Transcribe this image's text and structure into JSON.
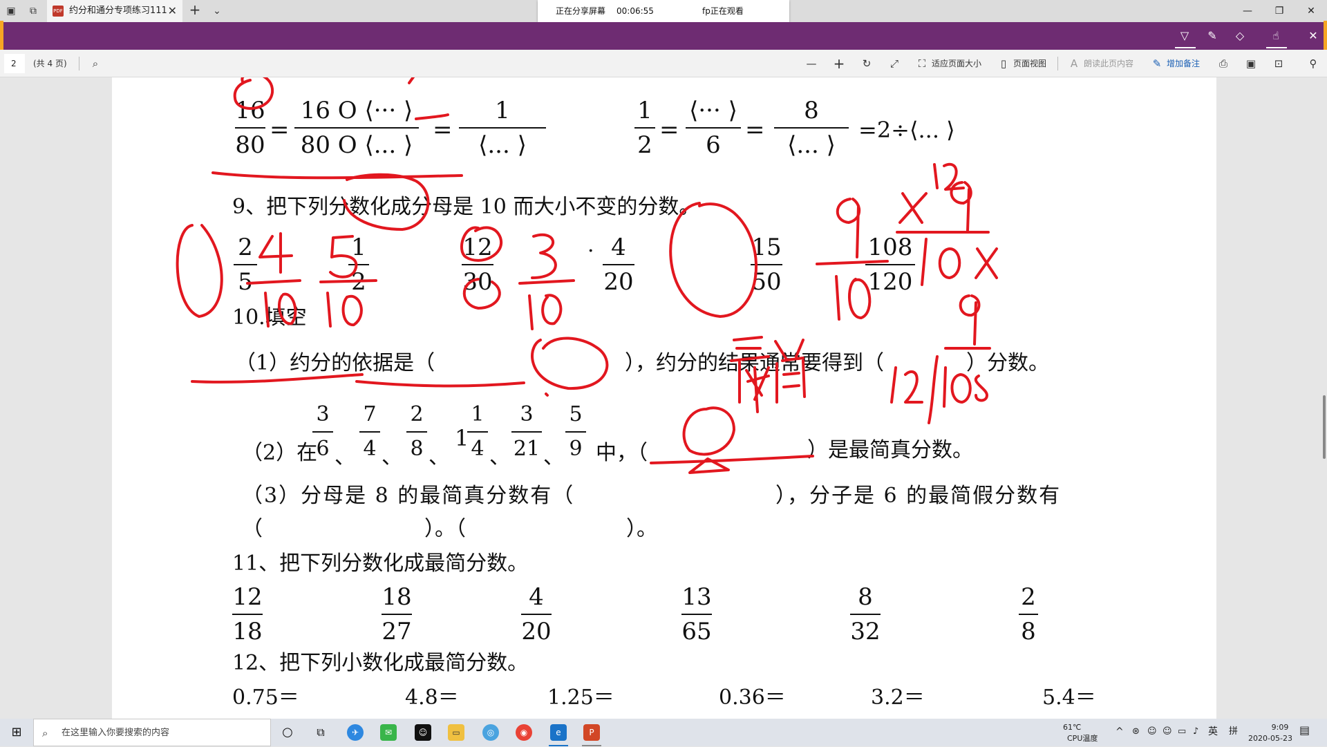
{
  "tab": {
    "title": "约分和通分专项练习111",
    "pdf_badge": "PDF"
  },
  "share": {
    "status": "正在分享屏幕",
    "timer": "00:06:55",
    "viewer": "fp正在观看"
  },
  "toolbar": {
    "page_current": "2",
    "page_total": "(共 4 页)",
    "fit_page": "适应页面大小",
    "page_view": "页面视图",
    "read_aloud": "朗读此页内容",
    "add_note": "增加备注"
  },
  "doc": {
    "r8": {
      "f1": [
        "16",
        "80"
      ],
      "f2_top": "16 O ⟨··· ⟩",
      "f2_bot": "80 O ⟨... ⟩",
      "eq": "=",
      "f3": [
        "1",
        "⟨...  ⟩"
      ],
      "f4": [
        "1",
        "2"
      ],
      "f5": [
        "⟨··· ⟩",
        "6"
      ],
      "f6": [
        "8",
        "⟨...  ⟩"
      ],
      "tail": "=2÷⟨... ⟩"
    },
    "q9_title": "9、把下列分数化成分母是 10 而大小不变的分数。",
    "q9": [
      [
        "2",
        "5"
      ],
      [
        "1",
        "2"
      ],
      [
        "12",
        "30"
      ],
      [
        "4",
        "20"
      ],
      [
        "15",
        "50"
      ],
      [
        "108",
        "120"
      ]
    ],
    "q9_dot": "·",
    "q10_title": "10.填空",
    "q10_1_a": "（1）约分的依据是（",
    "q10_1_b": "），约分的结果通常要得到（",
    "q10_1_c": "）分数。",
    "q10_2_pre": "（2）在",
    "q10_2_fracs": [
      [
        "3",
        "6"
      ],
      [
        "7",
        "4"
      ],
      [
        "2",
        "8"
      ],
      [
        "1",
        "4"
      ],
      [
        "3",
        "21"
      ],
      [
        "5",
        "9"
      ]
    ],
    "q10_2_whole": "1",
    "q10_2_sep": "、",
    "q10_2_mid": "中，（",
    "q10_2_end": "）是最简真分数。",
    "q10_3_a": "（3）分母是 8 的最简真分数有（",
    "q10_3_b": "），分子是 6 的最简假分数有",
    "q10_3_c": "（",
    "q10_3_d": "）。（",
    "q10_3_e": "）。",
    "q11_title": "11、把下列分数化成最简分数。",
    "q11": [
      [
        "12",
        "18"
      ],
      [
        "18",
        "27"
      ],
      [
        "4",
        "20"
      ],
      [
        "13",
        "65"
      ],
      [
        "8",
        "32"
      ],
      [
        "2",
        "8"
      ]
    ],
    "q12_title": "12、把下列小数化成最简分数。",
    "q12": [
      "0.75＝",
      "4.8＝",
      "1.25＝",
      "0.36＝",
      "3.2＝",
      "5.4＝"
    ]
  },
  "taskbar": {
    "search_placeholder": "在这里输入你要搜索的内容",
    "temp": "61℃",
    "temp_label": "CPU温度",
    "ime": "英",
    "ime2": "拼",
    "time": "9:09",
    "date": "2020-05-23"
  },
  "colors": {
    "ribbon": "#6e2c72",
    "ink": "#e2171f",
    "accent": "#f6a623"
  }
}
